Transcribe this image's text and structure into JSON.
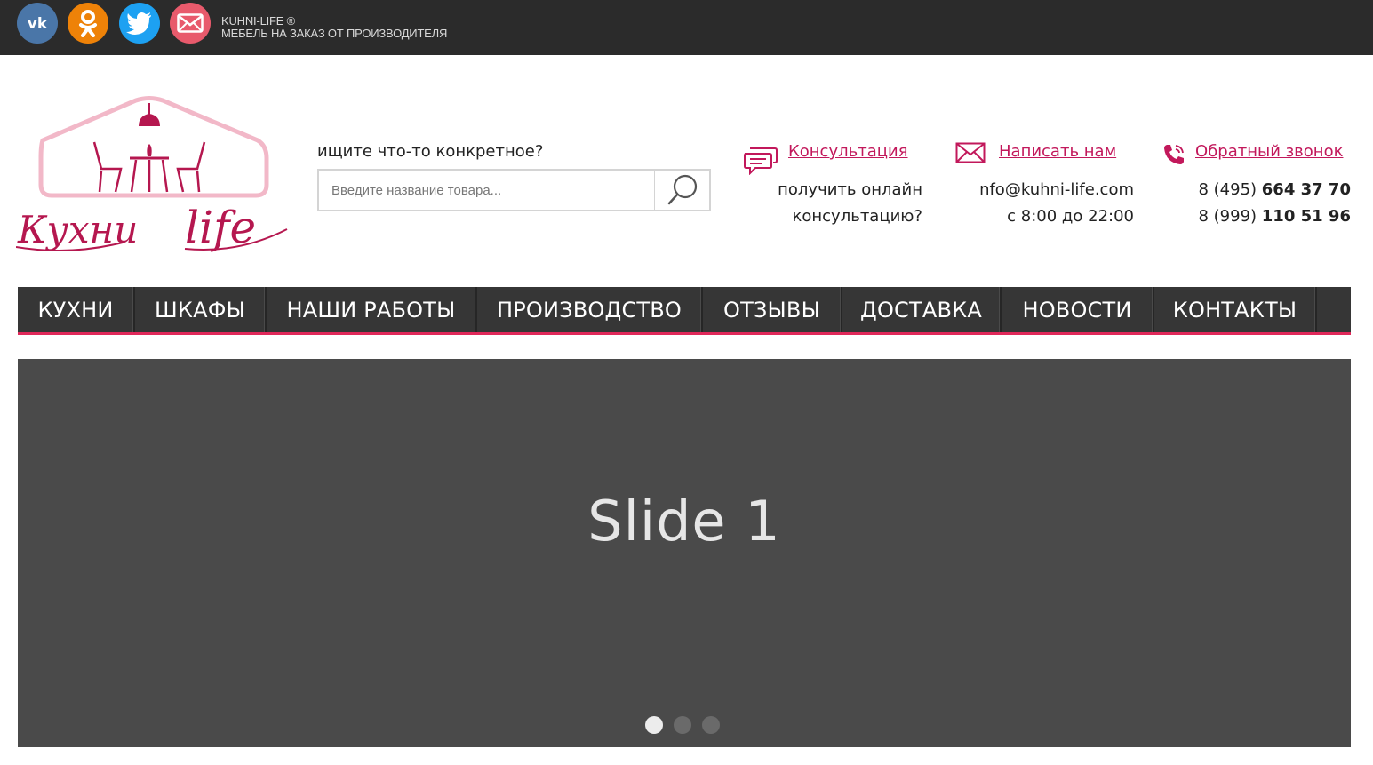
{
  "topbar": {
    "brand_name": "KUHNI-LIFE ®",
    "brand_tagline": "МЕБЕЛЬ НА ЗАКАЗ ОТ ПРОИЗВОДИТЕЛЯ",
    "social": [
      {
        "name": "vk",
        "icon": "vk-icon",
        "color": "#4a76a8"
      },
      {
        "name": "odnoklassniki",
        "icon": "odnoklassniki-icon",
        "color": "#ee8208"
      },
      {
        "name": "twitter",
        "icon": "twitter-icon",
        "color": "#1da1f2"
      },
      {
        "name": "mail",
        "icon": "mail-icon",
        "color": "#e85a6c"
      }
    ]
  },
  "logo": {
    "text": "Кухни life",
    "accent_color": "#b5174f"
  },
  "search": {
    "hint": "ищите что-то конкретное?",
    "placeholder": "Введите название товара...",
    "button_icon": "search-icon"
  },
  "contacts": {
    "consult": {
      "link": "Консультация",
      "line1": "получить онлайн",
      "line2": "консультацию?",
      "icon": "chat-icon"
    },
    "write": {
      "link": "Написать нам",
      "email": "nfo@kuhni-life.com",
      "hours": "с 8:00 до 22:00",
      "icon": "envelope-icon"
    },
    "call": {
      "link": "Обратный звонок",
      "phone1_prefix": "8 (495)",
      "phone1_number": "664 37 70",
      "phone2_prefix": "8 (999)",
      "phone2_number": "110 51 96",
      "icon": "phone-icon"
    },
    "link_color": "#c2185b"
  },
  "nav": {
    "items": [
      "КУХНИ",
      "ШКАФЫ",
      "НАШИ РАБОТЫ",
      "ПРОИЗВОДСТВО",
      "ОТЗЫВЫ",
      "ДОСТАВКА",
      "НОВОСТИ",
      "КОНТАКТЫ"
    ],
    "accent_color": "#e0285a"
  },
  "slider": {
    "title": "Slide 1",
    "total_slides": 3,
    "active_slide": 1
  }
}
